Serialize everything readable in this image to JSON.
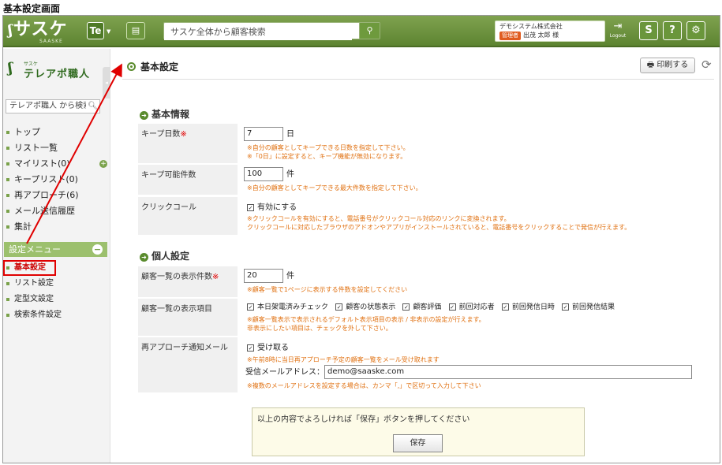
{
  "caption": "基本設定画面",
  "header": {
    "logo": "サスケ",
    "logo_sub": "SAASKE",
    "app_switch": "Te",
    "search_placeholder": "サスケ全体から顧客検索",
    "company": "デモシステム株式会社",
    "role_badge": "管理者",
    "user_name": "出茂 太郎 様",
    "logout_label": "Logout",
    "sasuke_icon": "S",
    "help_icon": "?",
    "settings_icon": "⚙"
  },
  "sidebar": {
    "brand_ruby": "サスケ",
    "brand": "テレアポ職人",
    "search_placeholder": "テレアポ職人 から検索",
    "items": [
      {
        "label": "トップ"
      },
      {
        "label": "リスト一覧"
      },
      {
        "label": "マイリスト(0)"
      },
      {
        "label": "キープリスト(0)"
      },
      {
        "label": "再アプローチ(6)"
      },
      {
        "label": "メール送信履歴"
      },
      {
        "label": "集計"
      }
    ],
    "settings_title": "設定メニュー",
    "settings_items": [
      {
        "label": "基本設定"
      },
      {
        "label": "リスト設定"
      },
      {
        "label": "定型文設定"
      },
      {
        "label": "検索条件設定"
      }
    ]
  },
  "main": {
    "title": "基本設定",
    "print_label": "印刷する",
    "section_basic": "基本情報",
    "keep_days": {
      "label": "キープ日数",
      "value": "7",
      "unit": "日",
      "note1": "※自分の顧客としてキープできる日数を指定して下さい。",
      "note2": "※「0日」に設定すると、キープ機能が無効になります。"
    },
    "keep_count": {
      "label": "キープ可能件数",
      "value": "100",
      "unit": "件",
      "note1": "※自分の顧客としてキープできる最大件数を指定して下さい。"
    },
    "click_call": {
      "label": "クリックコール",
      "option": "有効にする",
      "note1": "※クリックコールを有効にすると、電話番号がクリックコール対応のリンクに変換されます。",
      "note2": "クリックコールに対応したブラウザのアドオンやアプリがインストールされていると、電話番号をクリックすることで発信が行えます。"
    },
    "section_personal": "個人設定",
    "page_size": {
      "label": "顧客一覧の表示件数",
      "value": "20",
      "unit": "件",
      "note1": "※顧客一覧で1ページに表示する件数を設定してください"
    },
    "display_items": {
      "label": "顧客一覧の表示項目",
      "options": [
        "本日架電済みチェック",
        "顧客の状態表示",
        "顧客評価",
        "前回対応者",
        "前回発信日時",
        "前回発信結果"
      ],
      "note1": "※顧客一覧表示で表示されるデフォルト表示項目の表示 / 非表示の設定が行えます。",
      "note2": "非表示にしたい項目は、チェックを外して下さい。"
    },
    "reapproach": {
      "label": "再アプローチ通知メール",
      "option": "受け取る",
      "note1": "※午前8時に当日再アプローチ予定の顧客一覧をメール受け取れます",
      "email_label": "受信メールアドレス：",
      "email": "demo@saaske.com",
      "note2": "※複数のメールアドレスを設定する場合は、カンマ「,」で区切って入力して下さい"
    },
    "confirm_msg": "以上の内容でよろしければ「保存」ボタンを押してください",
    "save_label": "保存"
  }
}
